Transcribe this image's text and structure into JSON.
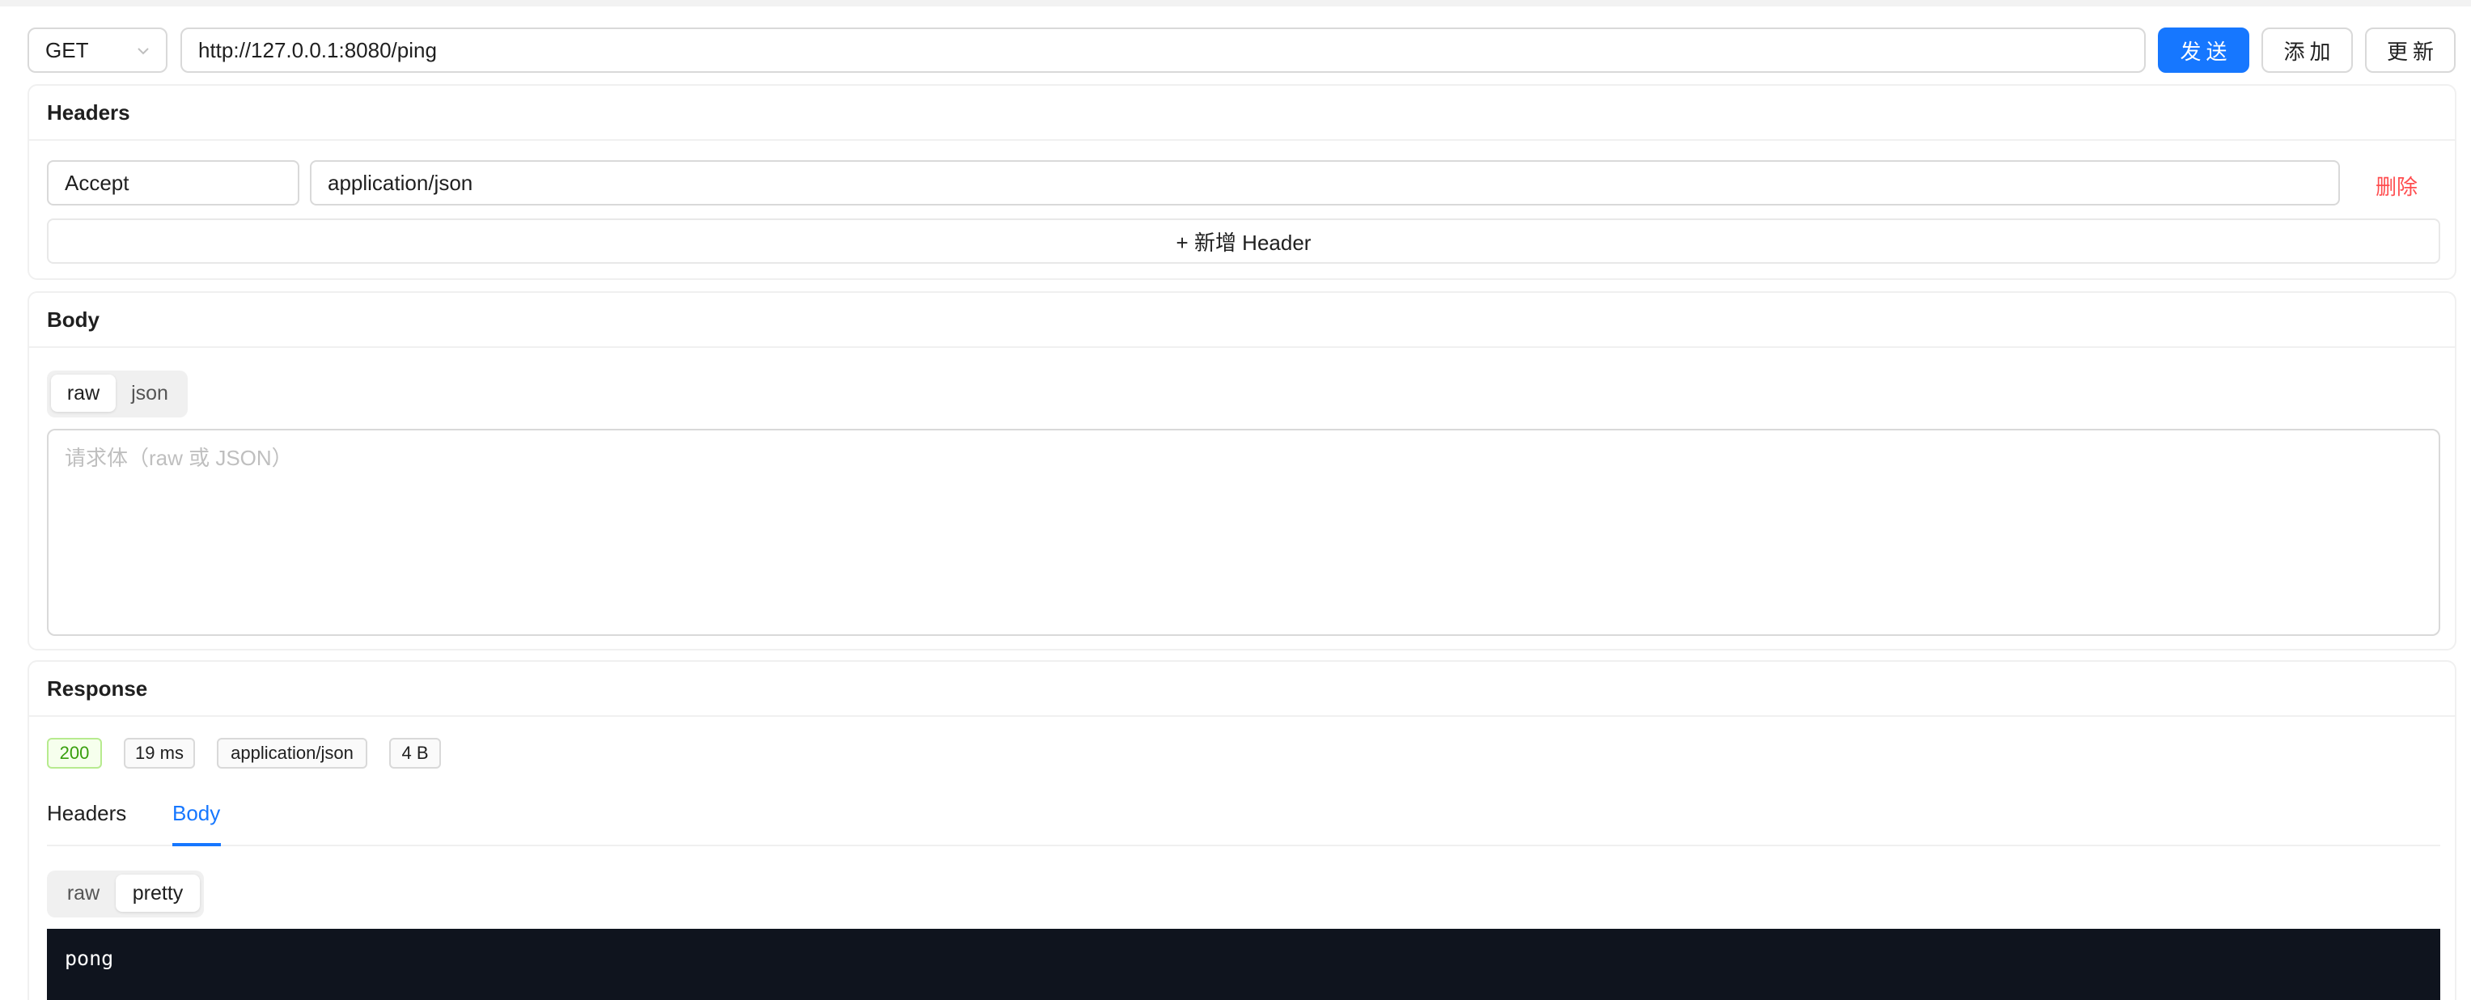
{
  "request": {
    "method": "GET",
    "url": "http://127.0.0.1:8080/ping",
    "send_label": "发送",
    "add_label": "添加",
    "update_label": "更新"
  },
  "headers_section": {
    "title": "Headers",
    "rows": [
      {
        "key": "Accept",
        "value": "application/json",
        "delete_label": "删除"
      }
    ],
    "add_label": "+ 新增 Header"
  },
  "body_section": {
    "title": "Body",
    "modes": [
      "raw",
      "json"
    ],
    "active_mode": "raw",
    "placeholder": "请求体（raw 或 JSON）"
  },
  "response_section": {
    "title": "Response",
    "status": "200",
    "time": "19 ms",
    "content_type": "application/json",
    "size": "4 B",
    "tabs": [
      "Headers",
      "Body"
    ],
    "active_tab": "Body",
    "view_modes": [
      "raw",
      "pretty"
    ],
    "active_view": "pretty",
    "body_text": "pong"
  },
  "colors": {
    "primary": "#1677ff",
    "danger": "#ff4d4f",
    "success": "#389e0d",
    "code_bg": "#0f141e"
  }
}
